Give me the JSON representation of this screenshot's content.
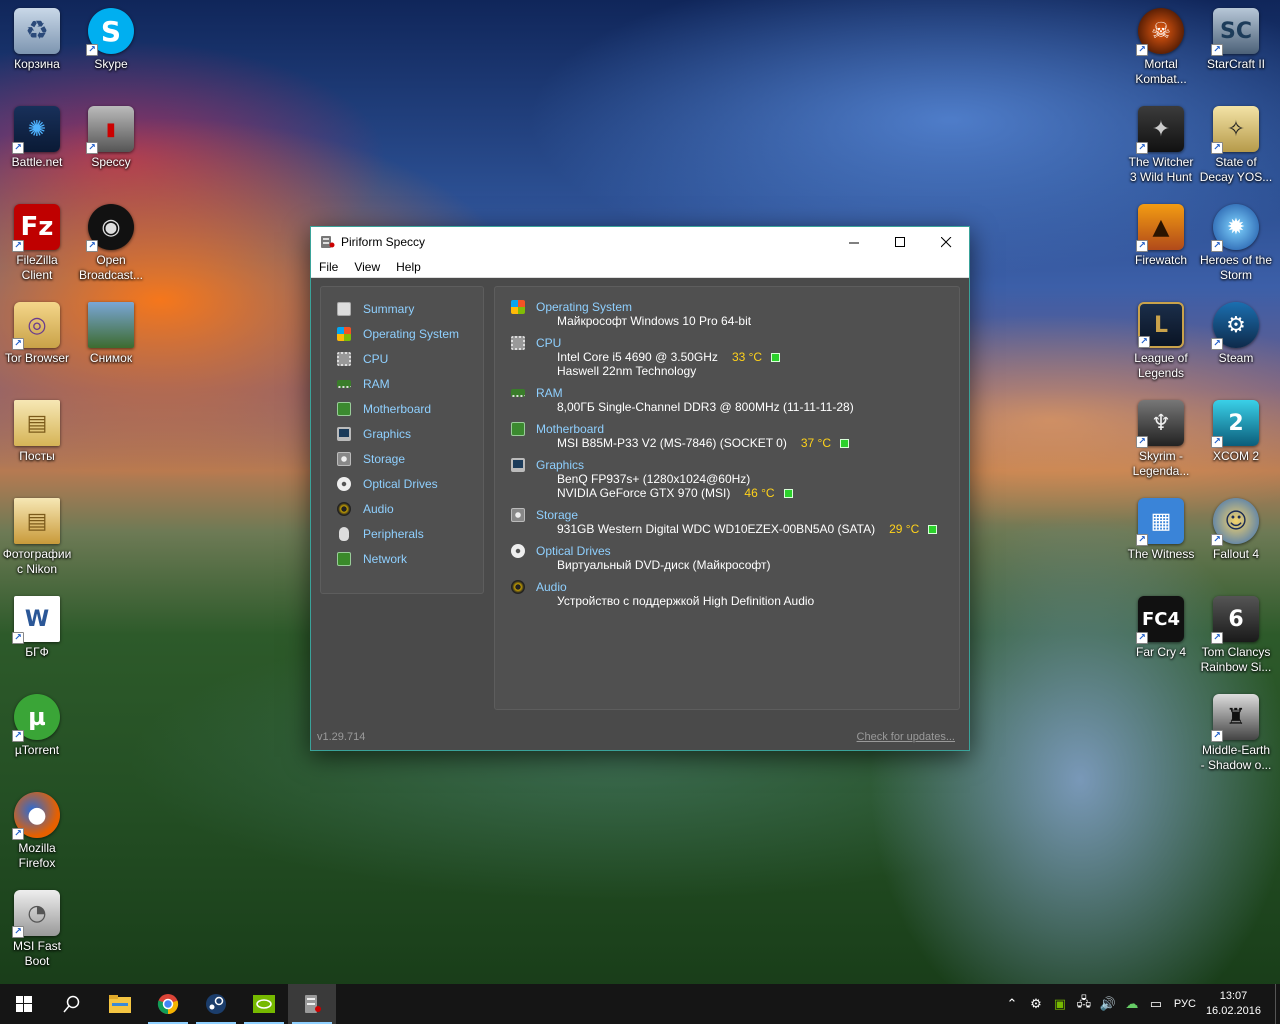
{
  "desktop_icons": {
    "recycle": "Корзина",
    "skype": "Skype",
    "battlenet": "Battle.net",
    "speccy": "Speccy",
    "filezilla": [
      "FileZilla",
      "Client"
    ],
    "obs": [
      "Open",
      "Broadcast..."
    ],
    "tor": "Tor Browser",
    "snimok": "Снимок",
    "posty": "Посты",
    "photos": [
      "Фотографии",
      "с Nikon"
    ],
    "bgf": "БГФ",
    "utorrent": "µTorrent",
    "firefox": [
      "Mozilla",
      "Firefox"
    ],
    "msiboot": [
      "MSI Fast",
      "Boot"
    ],
    "mortal": [
      "Mortal",
      "Kombat..."
    ],
    "starcraft": "StarCraft II",
    "witcher": [
      "The Witcher",
      "3 Wild Hunt"
    ],
    "sod": [
      "State of",
      "Decay YOS..."
    ],
    "firewatch": "Firewatch",
    "heroes": [
      "Heroes of the",
      "Storm"
    ],
    "lol": [
      "League of",
      "Legends"
    ],
    "steam": "Steam",
    "skyrim": [
      "Skyrim -",
      "Legenda..."
    ],
    "xcom": "XCOM 2",
    "witness": "The Witness",
    "fallout": "Fallout 4",
    "farcry": "Far Cry 4",
    "rainbow": [
      "Tom Clancys",
      "Rainbow Si..."
    ],
    "middleearth": [
      "Middle-Earth",
      "- Shadow o..."
    ]
  },
  "window": {
    "title": "Piriform Speccy",
    "menu": [
      "File",
      "View",
      "Help"
    ],
    "nav": [
      "Summary",
      "Operating System",
      "CPU",
      "RAM",
      "Motherboard",
      "Graphics",
      "Storage",
      "Optical Drives",
      "Audio",
      "Peripherals",
      "Network"
    ],
    "summary": {
      "os": {
        "title": "Operating System",
        "line1": "Майкрософт Windows 10 Pro 64-bit"
      },
      "cpu": {
        "title": "CPU",
        "line1": "Intel Core i5 4690 @ 3.50GHz",
        "temp": "33 °C",
        "line2": "Haswell 22nm Technology"
      },
      "ram": {
        "title": "RAM",
        "line1": "8,00ГБ Single-Channel DDR3 @ 800MHz (11-11-11-28)"
      },
      "motherboard": {
        "title": "Motherboard",
        "line1": "MSI B85M-P33 V2 (MS-7846) (SOCKET 0)",
        "temp": "37 °C"
      },
      "graphics": {
        "title": "Graphics",
        "line1": "BenQ FP937s+ (1280x1024@60Hz)",
        "line2": "NVIDIA GeForce GTX 970 (MSI)",
        "temp": "46 °C"
      },
      "storage": {
        "title": "Storage",
        "line1": "931GB Western Digital WDC WD10EZEX-00BN5A0 (SATA)",
        "temp": "29 °C"
      },
      "optical": {
        "title": "Optical Drives",
        "line1": "Виртуальный DVD-диск (Майкрософт)"
      },
      "audio": {
        "title": "Audio",
        "line1": "Устройство с поддержкой High Definition Audio"
      }
    },
    "version": "v1.29.714",
    "update_link": "Check for updates..."
  },
  "taskbar": {
    "lang": "РУС",
    "time": "13:07",
    "date": "16.02.2016"
  },
  "colors": {
    "accent": "#8fd0ff",
    "temp": "#ffd21a",
    "temp_ok": "#2bd12b",
    "window_border": "#3aa39a"
  }
}
